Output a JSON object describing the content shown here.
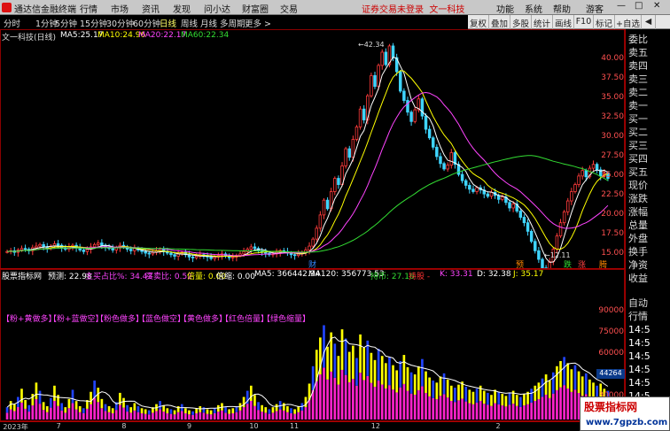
{
  "window": {
    "app_name": "通达信金融终端",
    "menu": [
      "行情",
      "市场",
      "资讯",
      "发现",
      "问小达",
      "财富圈",
      "交易"
    ],
    "notice": "证券交易未登录",
    "notice_stock": "文一科技",
    "right_menu": [
      "功能",
      "系统",
      "帮助"
    ],
    "guest": "游客",
    "controls": [
      "—",
      "□",
      "✕"
    ]
  },
  "period_bar": [
    "分时",
    "1分钟",
    "5分钟",
    "15分钟",
    "30分钟",
    "60分钟",
    "日线",
    "周线",
    "月线",
    "多周期",
    "更多 >"
  ],
  "period_active": "日线",
  "toolbar": [
    "复权",
    "叠加",
    "多股",
    "统计",
    "画线",
    "F10",
    "标记",
    "+自选",
    "◀"
  ],
  "right_panel": [
    "委比",
    "卖五",
    "卖四",
    "卖三",
    "卖二",
    "卖一",
    "买一",
    "买二",
    "买三",
    "买四",
    "买五",
    "现价",
    "涨跌",
    "涨幅",
    "总量",
    "外盘",
    "换手",
    "净资",
    "收益"
  ],
  "right_panel_lower": [
    "自动",
    "行情"
  ],
  "right_axis_lower": [
    "14:5",
    "14:5",
    "14:5",
    "14:5",
    "14:5",
    "14:5",
    "14:5",
    "14:5"
  ],
  "main_legend": {
    "title": "文一科技(日线)",
    "items": [
      {
        "label": "MA5:",
        "value": "25.17",
        "color": "#ffffff"
      },
      {
        "label": "MA10:",
        "value": "24.96",
        "color": "#ffff00"
      },
      {
        "label": "MA20:",
        "value": "22.17",
        "color": "#ff44ff"
      },
      {
        "label": "MA60:",
        "value": "22.34",
        "color": "#33dd33"
      }
    ]
  },
  "price_axis": [
    "40.00",
    "37.50",
    "35.00",
    "32.50",
    "30.00",
    "27.50",
    "25.00",
    "22.50",
    "20.00",
    "17.50",
    "15.00"
  ],
  "annotations": {
    "high": "42.34",
    "low": "12.11",
    "markers": [
      "财",
      "预",
      "跌",
      "涨",
      "腾"
    ]
  },
  "volume_legend": {
    "line1": [
      {
        "text": "股票指标网",
        "color": "#ffffff"
      },
      {
        "text": "预测: 22.98",
        "color": "#ffffff"
      },
      {
        "text": "主买占比%: 34.43",
        "color": "#ff44ff"
      },
      {
        "text": "买卖比: 0.52",
        "color": "#ff44ff"
      },
      {
        "text": "倍量: 0.00",
        "color": "#ffff00"
      },
      {
        "text": "倍缩: 0.00",
        "color": "#ffffff"
      },
      {
        "text": "MA5: 366442.94",
        "color": "#ffffff"
      },
      {
        "text": "MA120: 356773.53",
        "color": "#ffffff"
      },
      {
        "text": "持币: 27.16",
        "color": "#33dd33"
      },
      {
        "text": "持股 -",
        "color": "#ff3333"
      },
      {
        "text": "K: 33.31",
        "color": "#ff44ff"
      },
      {
        "text": "D: 32.38",
        "color": "#ffffff"
      },
      {
        "text": "J: 35.17",
        "color": "#ffff00"
      }
    ],
    "line2": [
      "【粉+黄做多】",
      "【粉+蓝做空】",
      "【粉色做多】",
      "【蓝色做空】",
      "【黄色做多】",
      "【红色倍量】",
      "【绿色缩量】"
    ]
  },
  "volume_axis": [
    "90000",
    "75000",
    "60000",
    "45000",
    "30000",
    "15000"
  ],
  "volume_tag": "44264",
  "date_labels": [
    {
      "text": "2023年",
      "pos": 0.005
    },
    {
      "text": "7",
      "pos": 0.095
    },
    {
      "text": "8",
      "pos": 0.205
    },
    {
      "text": "9",
      "pos": 0.315
    },
    {
      "text": "10",
      "pos": 0.42
    },
    {
      "text": "11",
      "pos": 0.488
    },
    {
      "text": "12",
      "pos": 0.625
    },
    {
      "text": "2",
      "pos": 0.835
    }
  ],
  "watermark": {
    "line1": "股票指标网",
    "line2": "www.7gpzb.com"
  },
  "chart_data": {
    "type": "candlestick",
    "ylim": [
      12.0,
      42.34
    ],
    "close": [
      15.2,
      15.3,
      15.1,
      15.4,
      15.6,
      15.5,
      15.3,
      15.7,
      15.9,
      16.1,
      15.8,
      15.6,
      15.9,
      16.2,
      16.0,
      15.7,
      15.5,
      15.8,
      16.0,
      15.7,
      15.4,
      15.2,
      15.5,
      15.8,
      16.1,
      16.3,
      16.0,
      15.8,
      15.6,
      15.4,
      15.7,
      16.0,
      15.8,
      15.5,
      15.3,
      15.6,
      15.4,
      15.2,
      15.0,
      14.9,
      15.1,
      15.3,
      15.5,
      15.2,
      15.0,
      14.8,
      14.6,
      14.9,
      15.1,
      14.8,
      14.5,
      14.4,
      14.6,
      14.8,
      14.7,
      14.5,
      14.3,
      14.5,
      14.7,
      14.9,
      14.6,
      14.4,
      14.5,
      14.7,
      14.9,
      15.2,
      15.5,
      15.8,
      15.6,
      15.3,
      15.1,
      15.0,
      14.8,
      14.9,
      15.1,
      15.3,
      15.2,
      15.0,
      14.8,
      14.7,
      14.9,
      15.1,
      15.4,
      15.9,
      16.8,
      18.2,
      19.9,
      21.8,
      20.7,
      22.9,
      24.6,
      23.8,
      26.2,
      28.4,
      27.3,
      29.6,
      31.2,
      33.5,
      32.1,
      35.2,
      37.8,
      36.4,
      39.1,
      40.8,
      39.2,
      41.6,
      40.1,
      38.3,
      35.8,
      34.6,
      33.1,
      31.9,
      33.4,
      34.8,
      32.6,
      30.9,
      29.8,
      28.6,
      27.4,
      26.5,
      25.8,
      26.3,
      27.9,
      26.4,
      25.1,
      24.3,
      23.7,
      23.2,
      22.9,
      23.4,
      23.1,
      22.6,
      22.3,
      22.8,
      22.4,
      21.9,
      22.2,
      21.5,
      20.8,
      21.3,
      20.4,
      19.6,
      18.9,
      17.8,
      16.5,
      15.3,
      14.2,
      13.1,
      12.6,
      13.9,
      15.5,
      17.2,
      18.9,
      20.3,
      21.7,
      22.9,
      23.8,
      24.9,
      25.6,
      24.8,
      25.9,
      26.4,
      25.7,
      24.9,
      25.3,
      24.6
    ],
    "volume": [
      12,
      18,
      15,
      22,
      30,
      19,
      14,
      25,
      36,
      28,
      17,
      13,
      21,
      33,
      24,
      16,
      12,
      20,
      29,
      18,
      13,
      11,
      19,
      27,
      38,
      31,
      20,
      15,
      13,
      11,
      17,
      26,
      21,
      14,
      12,
      16,
      13,
      11,
      10,
      9,
      12,
      15,
      18,
      14,
      11,
      10,
      9,
      13,
      15,
      11,
      9,
      8,
      11,
      13,
      12,
      10,
      9,
      11,
      14,
      16,
      12,
      10,
      11,
      13,
      16,
      22,
      28,
      33,
      24,
      17,
      14,
      12,
      10,
      12,
      15,
      18,
      16,
      13,
      11,
      10,
      13,
      16,
      22,
      35,
      52,
      68,
      80,
      92,
      71,
      85,
      74,
      62,
      88,
      79,
      66,
      72,
      60,
      83,
      70,
      77,
      65,
      58,
      69,
      62,
      55,
      61,
      53,
      48,
      57,
      63,
      51,
      46,
      44,
      52,
      59,
      47,
      41,
      38,
      36,
      42,
      45,
      39,
      33,
      31,
      34,
      37,
      32,
      29,
      27,
      30,
      33,
      28,
      26,
      24,
      29,
      27,
      25,
      23,
      26,
      28,
      24,
      22,
      25,
      27,
      30,
      33,
      36,
      40,
      44,
      38,
      46,
      52,
      57,
      61,
      55,
      49,
      53,
      47,
      42,
      45,
      39,
      36,
      33,
      35,
      30,
      28
    ]
  }
}
